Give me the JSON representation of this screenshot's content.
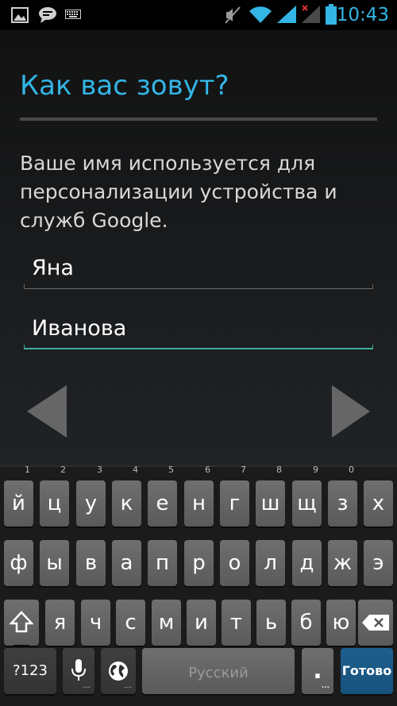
{
  "status_bar": {
    "time": "10:43",
    "left_icons": [
      "image-icon",
      "chat-bubble-icon",
      "keyboard-icon"
    ],
    "right_icons": [
      "mute-icon",
      "wifi-icon",
      "signal-icon",
      "signal-off-icon",
      "battery-icon"
    ],
    "accent": "#33b5e5"
  },
  "setup": {
    "title": "Как вас зовут?",
    "description": "Ваше имя используется для персонализации устройства и служб Google.",
    "first_name": "Яна",
    "last_name": "Иванова",
    "prev_icon": "triangle-left-icon",
    "next_icon": "triangle-right-icon"
  },
  "keyboard": {
    "row1": [
      {
        "label": "й",
        "hint": "1"
      },
      {
        "label": "ц",
        "hint": "2"
      },
      {
        "label": "у",
        "hint": "3"
      },
      {
        "label": "к",
        "hint": "4"
      },
      {
        "label": "е",
        "hint": "5"
      },
      {
        "label": "н",
        "hint": "6"
      },
      {
        "label": "г",
        "hint": "7"
      },
      {
        "label": "ш",
        "hint": "8"
      },
      {
        "label": "щ",
        "hint": "9"
      },
      {
        "label": "з",
        "hint": "0"
      },
      {
        "label": "х",
        "hint": ""
      }
    ],
    "row2": [
      "ф",
      "ы",
      "в",
      "а",
      "п",
      "р",
      "о",
      "л",
      "д",
      "ж",
      "э"
    ],
    "row3": [
      "я",
      "ч",
      "с",
      "м",
      "и",
      "т",
      "ь",
      "б",
      "ю"
    ],
    "symbols_label": "?123",
    "space_label": "Русский",
    "period_label": ".",
    "done_label": "Готово",
    "shift_icon": "shift-icon",
    "backspace_icon": "backspace-icon",
    "mic_icon": "microphone-icon",
    "globe_icon": "globe-icon"
  }
}
